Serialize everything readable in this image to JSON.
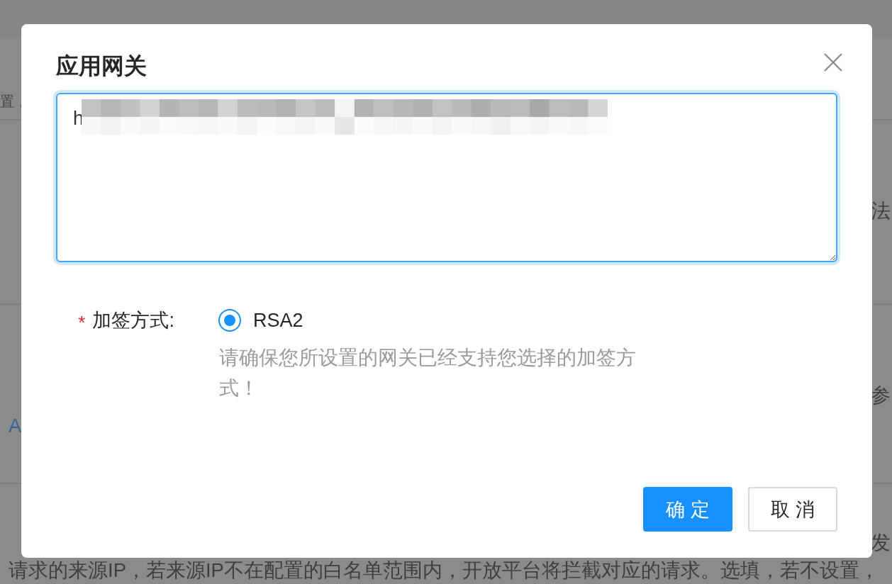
{
  "background_page": {
    "sections": [
      {
        "rows": [
          {
            "left": {
              "kind": "text",
              "text": "置，"
            }
          }
        ]
      },
      {
        "rows": [
          {
            "right": {
              "kind": "text",
              "text": "法"
            }
          }
        ]
      },
      {
        "rows": [
          {
            "right": {
              "kind": "text",
              "text": "参"
            }
          },
          {
            "left": {
              "kind": "link",
              "text": "A"
            }
          }
        ]
      },
      {
        "rows": [
          {
            "right": {
              "kind": "text",
              "text": "发"
            }
          },
          {
            "left": {
              "kind": "text",
              "text": "请求的来源IP，若来源IP不在配置的白名单范围内，开放平台将拦截对应的请求。选填，若不设置，"
            }
          }
        ]
      }
    ]
  },
  "dialog": {
    "title": "应用网关",
    "gateway_field": {
      "value": "h",
      "focused": true
    },
    "signing_method": {
      "required_mark": "*",
      "label": "加签方式:",
      "options": [
        {
          "label": "RSA2",
          "selected": true
        }
      ],
      "hint": "请确保您所设置的网关已经支持您选择的加签方式！"
    },
    "buttons": [
      {
        "kind": "primary",
        "label": "确 定"
      },
      {
        "kind": "default",
        "label": "取 消"
      }
    ]
  }
}
